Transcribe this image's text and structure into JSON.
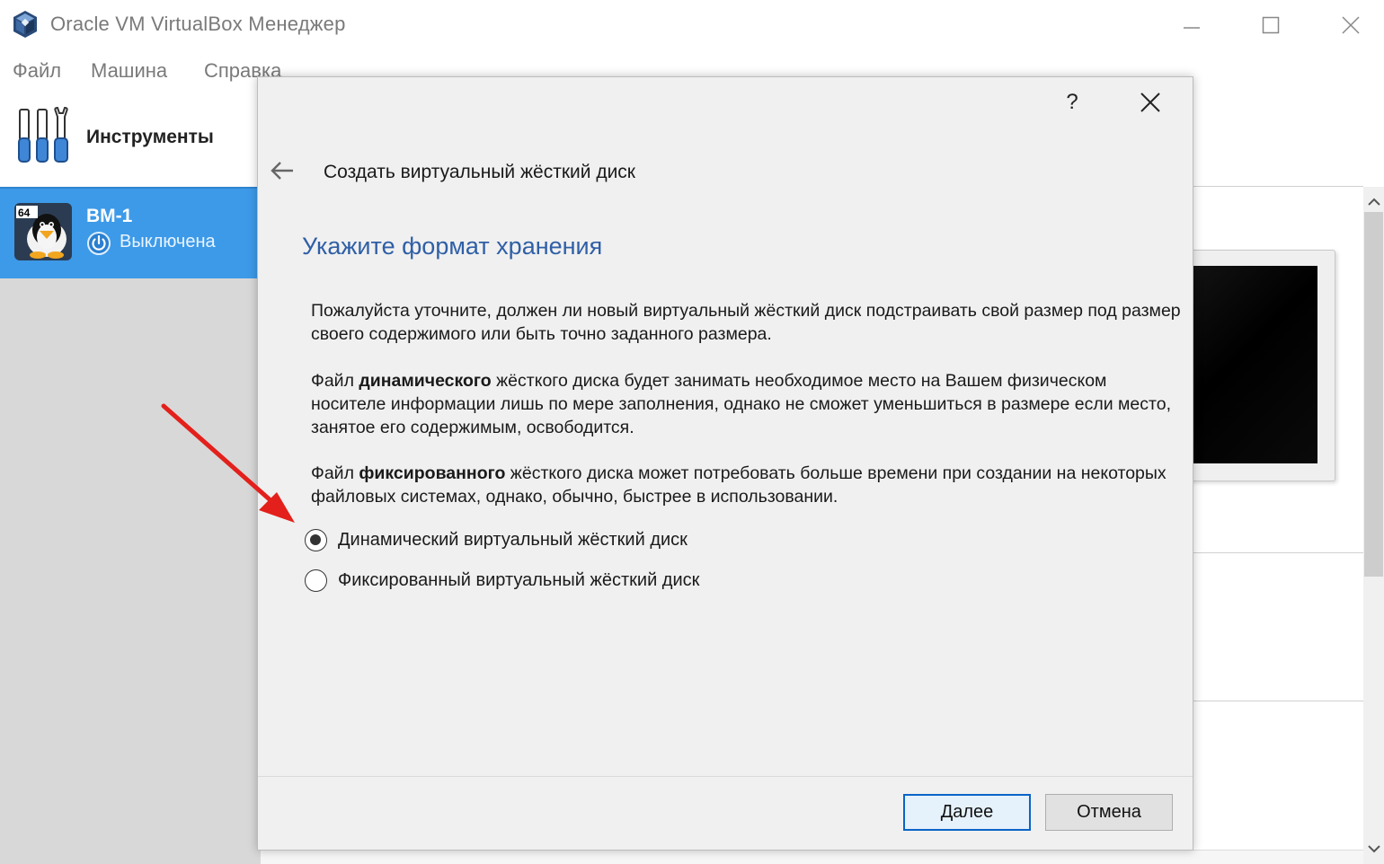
{
  "window": {
    "title": "Oracle VM VirtualBox Менеджер",
    "icon": "virtualbox-logo-icon",
    "controls": [
      "minimize-icon",
      "maximize-icon",
      "close-icon"
    ]
  },
  "menu": {
    "items": [
      "Файл",
      "Машина",
      "Справка"
    ]
  },
  "sidebar": {
    "tools": {
      "label": "Инструменты",
      "icon": "tools-icon"
    },
    "vms": [
      {
        "name": "ВМ-1",
        "status": "Выключена",
        "os_badge": "64",
        "icon": "linux-penguin-icon",
        "status_icon": "power-off-icon",
        "selected": true
      }
    ]
  },
  "dialog": {
    "help_label": "?",
    "title": "Создать виртуальный жёсткий диск",
    "heading": "Укажите формат хранения",
    "intro": "Пожалуйста уточните, должен ли новый виртуальный жёсткий диск подстраивать свой размер под размер своего содержимого или быть точно заданного размера.",
    "dynamic_desc": {
      "prefix": "Файл ",
      "bold": "динамического",
      "suffix": " жёсткого диска будет занимать необходимое место на Вашем физическом носителе информации лишь по мере заполнения, однако не сможет уменьшиться в размере если место, занятое его содержимым, освободится."
    },
    "fixed_desc": {
      "prefix": "Файл ",
      "bold": "фиксированного",
      "suffix": " жёсткого диска может потребовать больше времени при создании на некоторых файловых системах, однако, обычно, быстрее в использовании."
    },
    "options": [
      {
        "label": "Динамический виртуальный жёсткий диск",
        "checked": true
      },
      {
        "label": "Фиксированный виртуальный жёсткий диск",
        "checked": false
      }
    ],
    "buttons": {
      "next": "Далее",
      "cancel": "Отмена"
    }
  },
  "colors": {
    "accent": "#3d9ae8",
    "heading": "#2f5fa6",
    "annotation_arrow": "#e3201b"
  }
}
